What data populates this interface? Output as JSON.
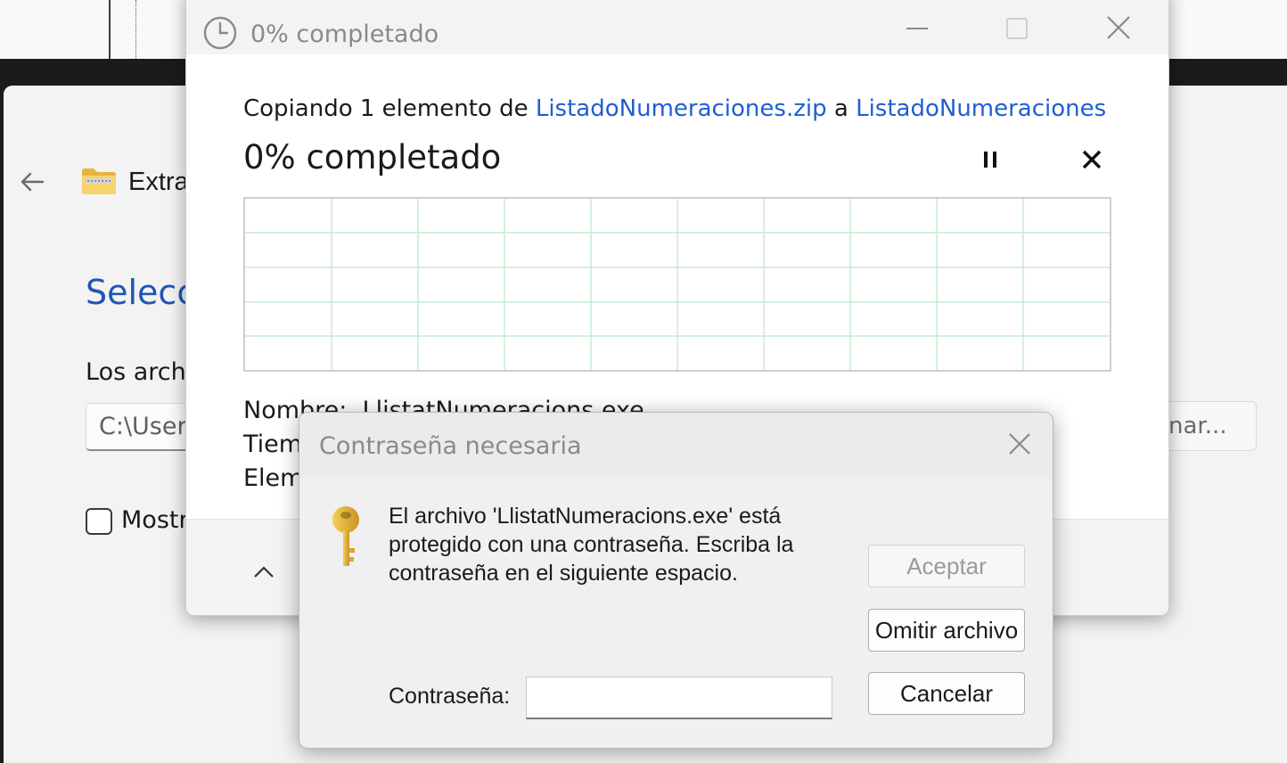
{
  "background_window": {
    "back_label": "←",
    "title_partial": "Extra",
    "heading_partial": "Selecci",
    "label_partial": "Los arch",
    "path_partial": "C:\\User",
    "checkbox_label_partial": "Mostr",
    "browse_partial": "nar..."
  },
  "copy_dialog": {
    "window_title": "0% completado",
    "line_prefix": "Copiando 1 elemento de ",
    "source_link": "ListadoNumeraciones.zip",
    "line_middle": " a ",
    "dest_link": "ListadoNumeraciones",
    "percent_text": "0% completado",
    "progress_percent": 0,
    "name_label": "Nombre:",
    "name_value": "LlistatNumeracions.exe",
    "time_label_partial": "Tiem",
    "items_label_partial": "Elem",
    "footer_partial": "I"
  },
  "password_dialog": {
    "title": "Contraseña necesaria",
    "message": "El archivo 'LlistatNumeracions.exe' está protegido con una contraseña. Escriba la contraseña en el siguiente espacio.",
    "accept_button": "Aceptar",
    "skip_button": "Omitir archivo",
    "cancel_button": "Cancelar",
    "password_label": "Contraseña:",
    "password_value": ""
  },
  "colors": {
    "link": "#1f5fd1",
    "heading": "#1f56b5",
    "grid": "#c9ecd0"
  }
}
